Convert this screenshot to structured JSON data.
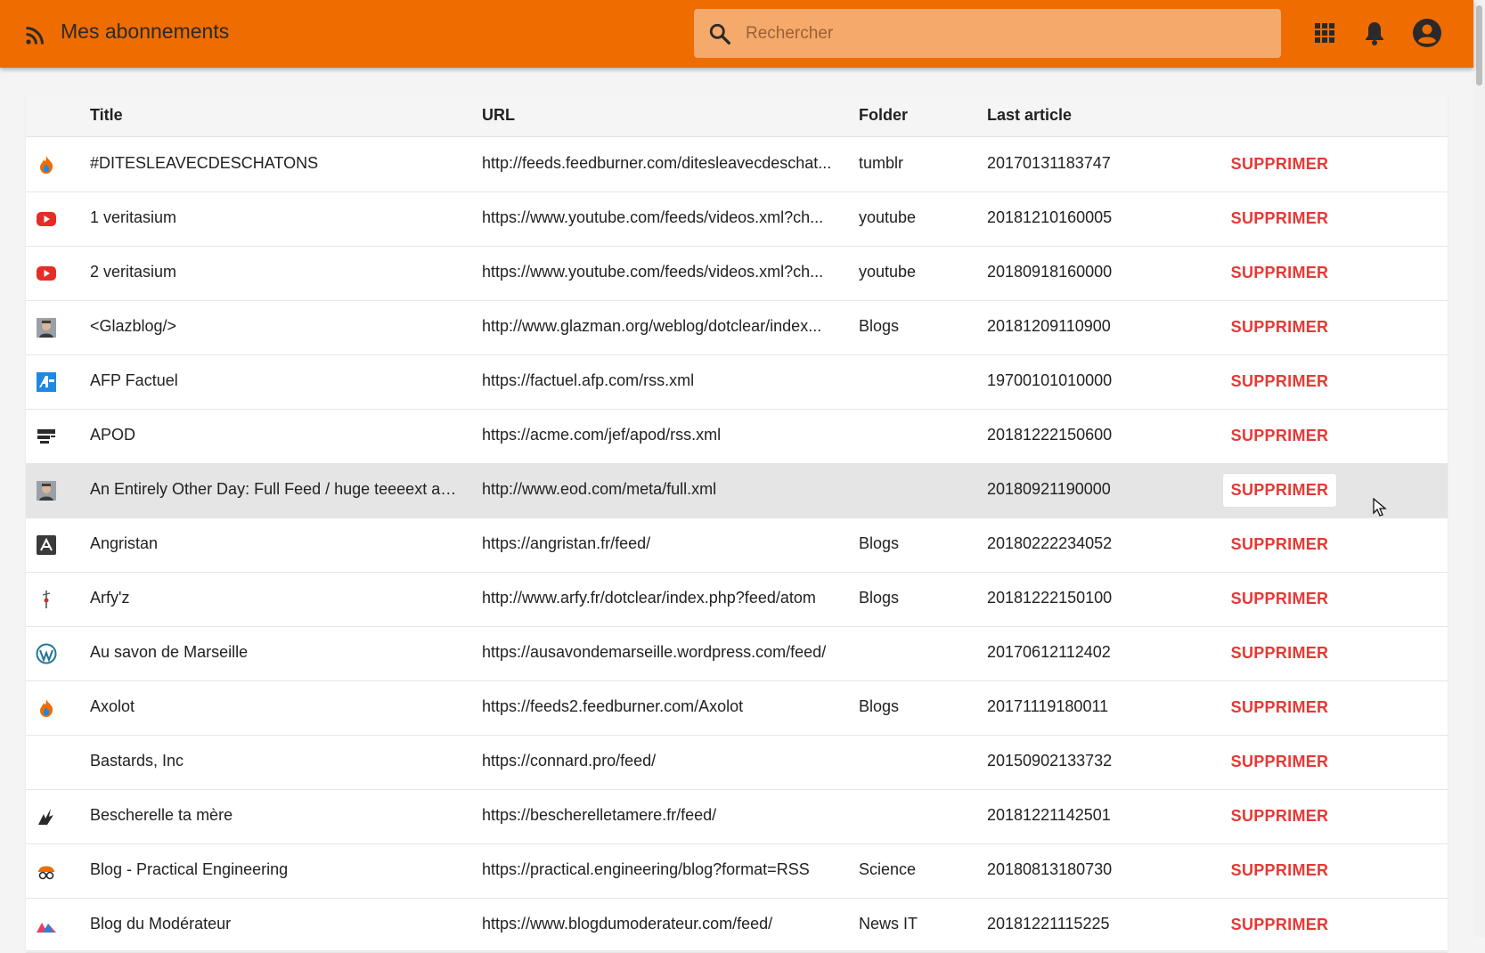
{
  "header": {
    "title": "Mes abonnements",
    "search_placeholder": "Rechercher",
    "color": "#ef6c00"
  },
  "table": {
    "columns": {
      "title": "Title",
      "url": "URL",
      "folder": "Folder",
      "last_article": "Last article"
    },
    "delete_label": "SUPPRIMER",
    "delete_color": "#e53935",
    "rows": [
      {
        "icon": "feedburner-icon",
        "title": "#DITESLEAVECDESCHATONS",
        "url": "http://feeds.feedburner.com/ditesleavecdeschat...",
        "folder": "tumblr",
        "last_article": "20170131183747"
      },
      {
        "icon": "youtube-icon",
        "title": "1 veritasium",
        "url": "https://www.youtube.com/feeds/videos.xml?ch...",
        "folder": "youtube",
        "last_article": "20181210160005"
      },
      {
        "icon": "youtube-icon",
        "title": "2 veritasium",
        "url": "https://www.youtube.com/feeds/videos.xml?ch...",
        "folder": "youtube",
        "last_article": "20180918160000"
      },
      {
        "icon": "portrait-icon",
        "title": "<Glazblog/>",
        "url": "http://www.glazman.org/weblog/dotclear/index...",
        "folder": "Blogs",
        "last_article": "20181209110900"
      },
      {
        "icon": "afp-icon",
        "title": "AFP Factuel",
        "url": "https://factuel.afp.com/rss.xml",
        "folder": "",
        "last_article": "19700101010000"
      },
      {
        "icon": "apod-icon",
        "title": "APOD",
        "url": "https://acme.com/jef/apod/rss.xml",
        "folder": "",
        "last_article": "20181222150600"
      },
      {
        "icon": "portrait-icon",
        "title": "An Entirely Other Day: Full Feed / huge teeeext aaa...",
        "url": "http://www.eod.com/meta/full.xml",
        "folder": "",
        "last_article": "20180921190000"
      },
      {
        "icon": "angristan-icon",
        "title": "Angristan",
        "url": "https://angristan.fr/feed/",
        "folder": "Blogs",
        "last_article": "20180222234052"
      },
      {
        "icon": "arfyz-icon",
        "title": "Arfy'z",
        "url": "http://www.arfy.fr/dotclear/index.php?feed/atom",
        "folder": "Blogs",
        "last_article": "20181222150100"
      },
      {
        "icon": "wordpress-icon",
        "title": "Au savon de Marseille",
        "url": "https://ausavondemarseille.wordpress.com/feed/",
        "folder": "",
        "last_article": "20170612112402"
      },
      {
        "icon": "feedburner-icon",
        "title": "Axolot",
        "url": "https://feeds2.feedburner.com/Axolot",
        "folder": "Blogs",
        "last_article": "20171119180011"
      },
      {
        "icon": "",
        "title": "Bastards, Inc",
        "url": "https://connard.pro/feed/",
        "folder": "",
        "last_article": "20150902133732"
      },
      {
        "icon": "bescherelle-icon",
        "title": "Bescherelle ta mère",
        "url": "https://bescherelletamere.fr/feed/",
        "folder": "",
        "last_article": "20181221142501"
      },
      {
        "icon": "engineer-icon",
        "title": "Blog - Practical Engineering",
        "url": "https://practical.engineering/blog?format=RSS",
        "folder": "Science",
        "last_article": "20180813180730"
      },
      {
        "icon": "moderateur-icon",
        "title": "Blog du Modérateur",
        "url": "https://www.blogdumoderateur.com/feed/",
        "folder": "News IT",
        "last_article": "20181221115225"
      }
    ]
  }
}
